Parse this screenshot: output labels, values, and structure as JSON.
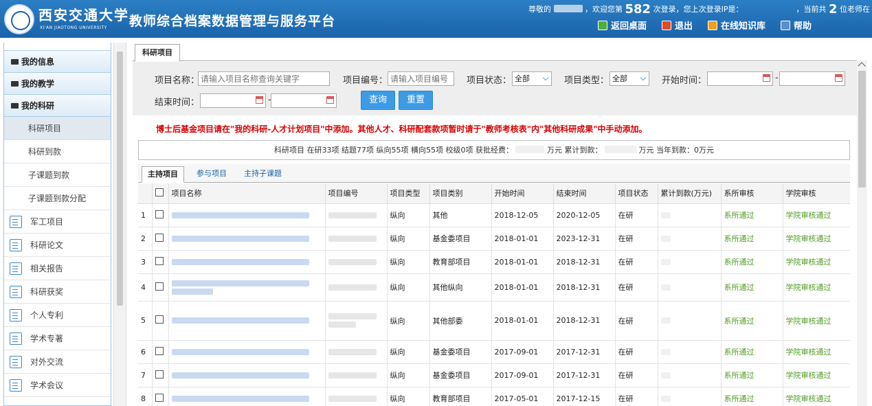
{
  "header": {
    "school_cn": "西安交通大学",
    "school_en": "XI'AN JIAOTONG UNIVERSITY",
    "app_title": "教师综合档案数据管理与服务平台",
    "greet_prefix": "尊敬的",
    "greet_mid": "，欢迎您第",
    "login_count": "582",
    "greet_suffix": "次登录，您上次登录IP是：",
    "online_prefix": "，当前共",
    "online_count": "2",
    "online_suffix": "位老师在",
    "toolbar": [
      {
        "label": "返回桌面",
        "icon": "desktop-icon",
        "color": "#4cae3b"
      },
      {
        "label": "退出",
        "icon": "power-icon",
        "color": "#e04b2a"
      },
      {
        "label": "在线知识库",
        "icon": "mail-icon",
        "color": "#f0a020"
      },
      {
        "label": "帮助",
        "icon": "help-icon",
        "color": "#5b8fd0"
      }
    ]
  },
  "sidebar": {
    "groups": [
      "我的信息",
      "我的教学",
      "我的科研"
    ],
    "research_items": [
      "科研项目",
      "科研到款",
      "子课题到款",
      "子课题到款分配"
    ],
    "icon_items": [
      "军工项目",
      "科研论文",
      "相关报告",
      "科研获奖",
      "个人专利",
      "学术专著",
      "对外交流",
      "学术会议"
    ]
  },
  "main": {
    "tab": "科研项目",
    "search": {
      "name_label": "项目名称：",
      "name_placeholder": "请输入项目名称查询关键字",
      "code_label": "项目编号：",
      "code_placeholder": "请输入项目编号",
      "status_label": "项目状态：",
      "status_value": "全部",
      "type_label": "项目类型：",
      "type_value": "全部",
      "start_label": "开始时间：",
      "end_label": "结束时间：",
      "dash": "-",
      "query_btn": "查询",
      "reset_btn": "重置"
    },
    "warning": "博士后基金项目请在\"我的科研-人才计划项目\"中添加。其他人才、科研配套款项暂时请于\"教师考核表\"内\"其他科研成果\"中手动添加。",
    "stats": {
      "part1": "科研项目 在研33项 结题77项 纵向55项 横向55项 校级0项 获批经费：",
      "part2": "万元 累计到款：",
      "part3": "万元 当年到款：0万元"
    },
    "subtabs": [
      "主持项目",
      "参与项目",
      "主持子课题"
    ],
    "columns": [
      "项目名称",
      "项目编号",
      "项目类型",
      "项目类别",
      "开始时间",
      "结束时间",
      "项目状态",
      "累计到款(万元)",
      "系所审核",
      "学院审核"
    ],
    "rows": [
      {
        "no": "1",
        "type": "纵向",
        "category": "其他",
        "start": "2018-12-05",
        "end": "2020-12-05",
        "status": "在研",
        "dept": "系所通过",
        "college": "学院审核通过"
      },
      {
        "no": "2",
        "type": "纵向",
        "category": "基金委项目",
        "start": "2018-01-01",
        "end": "2023-12-31",
        "status": "在研",
        "dept": "系所通过",
        "college": "学院审核通过"
      },
      {
        "no": "3",
        "type": "纵向",
        "category": "教育部项目",
        "start": "2018-01-01",
        "end": "2018-12-31",
        "status": "在研",
        "dept": "系所通过",
        "college": "学院审核通过"
      },
      {
        "no": "4",
        "type": "纵向",
        "category": "其他纵向",
        "start": "2018-01-01",
        "end": "2018-12-31",
        "status": "在研",
        "dept": "系所通过",
        "college": "学院审核通过"
      },
      {
        "no": "5",
        "type": "纵向",
        "category": "其他部委",
        "start": "2018-01-01",
        "end": "2018-12-31",
        "status": "在研",
        "dept": "系所通过",
        "college": "学院审核通过"
      },
      {
        "no": "6",
        "type": "纵向",
        "category": "基金委项目",
        "start": "2017-09-01",
        "end": "2017-12-31",
        "status": "在研",
        "dept": "系所通过",
        "college": "学院审核通过"
      },
      {
        "no": "7",
        "type": "纵向",
        "category": "基金委项目",
        "start": "2017-09-01",
        "end": "2017-12-31",
        "status": "在研",
        "dept": "系所通过",
        "college": "学院审核通过"
      },
      {
        "no": "8",
        "type": "纵向",
        "category": "教育部项目",
        "start": "2017-05-01",
        "end": "2017-12-15",
        "status": "在研",
        "dept": "系所通过",
        "college": "学院审核通过"
      }
    ]
  }
}
